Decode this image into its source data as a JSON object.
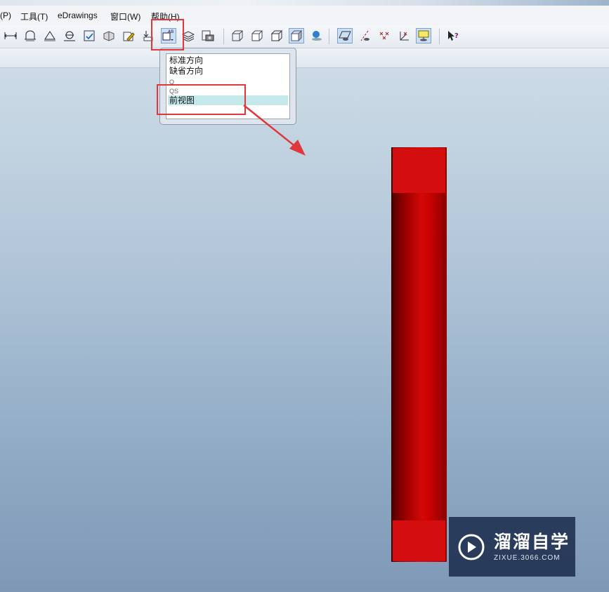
{
  "menu": {
    "items": [
      "(P)",
      "工具(T)",
      "eDrawings",
      "窗口(W)",
      "帮助(H)"
    ]
  },
  "toolbar": {
    "icons": [
      "measure-icon",
      "dimension-icon",
      "angle-icon",
      "diameter-icon",
      "view-check-icon",
      "section-icon",
      "markup-icon",
      "insert-icon",
      "orientation-dropdown-icon",
      "layers-icon",
      "snapshot-icon",
      "wireframe-icon",
      "hidden-lines-icon",
      "shaded-edges-icon",
      "shaded-icon",
      "perspective-icon",
      "plane-icon",
      "axis-icon",
      "point-icon",
      "coordinate-icon",
      "sketch-icon",
      "help-pointer-icon"
    ]
  },
  "orientation_dropdown": {
    "options": [
      "标准方向",
      "缺省方向",
      "Q",
      "QS",
      "前视图"
    ],
    "selected_index": 4
  },
  "watermark": {
    "title": "溜溜自学",
    "url": "ZIXUE.3066.COM"
  },
  "colors": {
    "highlight": "#e0373d",
    "selection": "#c5e9ea",
    "pipe": "#d40e0e"
  }
}
